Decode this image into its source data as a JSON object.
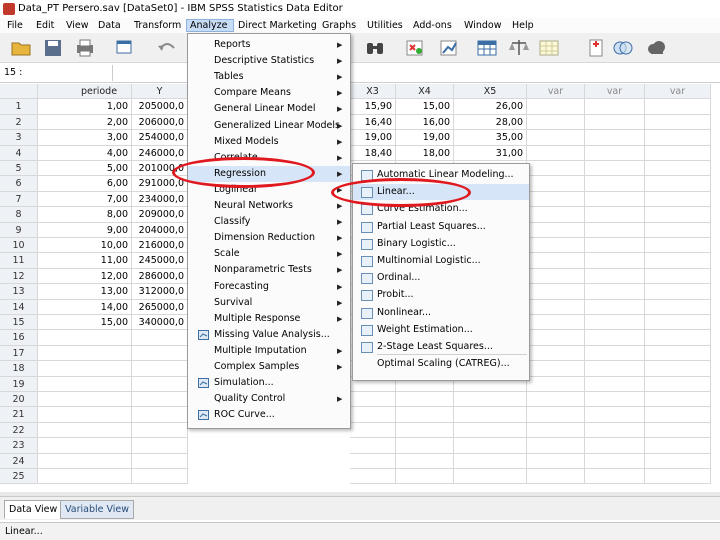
{
  "window": {
    "title": "Data_PT Persero.sav [DataSet0] - IBM SPSS Statistics Data Editor"
  },
  "menubar": [
    "File",
    "Edit",
    "View",
    "Data",
    "Transform",
    "Analyze",
    "Direct Marketing",
    "Graphs",
    "Utilities",
    "Add-ons",
    "Window",
    "Help"
  ],
  "toolbar_icons": [
    "open-icon",
    "save-icon",
    "print-icon",
    "dialog-recall-icon",
    "undo-icon",
    "binoculars-icon",
    "cases-icon",
    "chart-icon",
    "table-icon",
    "scale-icon",
    "select-icon",
    "value-labels-icon",
    "sets-icon",
    "cloud-icon"
  ],
  "editbar": {
    "cell_ref": "15 :",
    "cell_value": ""
  },
  "grid": {
    "columns": [
      "periode",
      "Y",
      "X3",
      "X4",
      "X5",
      "var",
      "var",
      "var"
    ],
    "row_numbers": [
      "1",
      "2",
      "3",
      "4",
      "5",
      "6",
      "7",
      "8",
      "9",
      "10",
      "11",
      "12",
      "13",
      "14",
      "15",
      "16",
      "17",
      "18",
      "19",
      "20",
      "21",
      "22",
      "23",
      "24",
      "25"
    ],
    "rows": [
      [
        "1,00",
        "205000,0",
        "15,90",
        "15,00",
        "26,00"
      ],
      [
        "2,00",
        "206000,0",
        "16,40",
        "16,00",
        "28,00"
      ],
      [
        "3,00",
        "254000,0",
        "19,00",
        "19,00",
        "35,00"
      ],
      [
        "4,00",
        "246000,0",
        "18,40",
        "18,00",
        "31,00"
      ],
      [
        "5,00",
        "201000,0",
        "",
        "",
        ""
      ],
      [
        "6,00",
        "291000,0",
        "",
        "",
        ""
      ],
      [
        "7,00",
        "234000,0",
        "",
        "",
        ""
      ],
      [
        "8,00",
        "209000,0",
        "",
        "",
        ""
      ],
      [
        "9,00",
        "204000,0",
        "",
        "",
        ""
      ],
      [
        "10,00",
        "216000,0",
        "",
        "",
        ""
      ],
      [
        "11,00",
        "245000,0",
        "",
        "",
        ""
      ],
      [
        "12,00",
        "286000,0",
        "",
        "",
        ""
      ],
      [
        "13,00",
        "312000,0",
        "",
        "",
        ""
      ],
      [
        "14,00",
        "265000,0",
        "",
        "",
        ""
      ],
      [
        "15,00",
        "340000,0",
        "",
        "",
        ""
      ]
    ]
  },
  "analyze_menu": [
    {
      "label": "Reports",
      "submenu": true
    },
    {
      "label": "Descriptive Statistics",
      "submenu": true
    },
    {
      "label": "Tables",
      "submenu": true
    },
    {
      "label": "Compare Means",
      "submenu": true
    },
    {
      "label": "General Linear Model",
      "submenu": true
    },
    {
      "label": "Generalized Linear Models",
      "submenu": true
    },
    {
      "label": "Mixed Models",
      "submenu": true
    },
    {
      "label": "Correlate",
      "submenu": true
    },
    {
      "label": "Regression",
      "submenu": true,
      "highlighted": true
    },
    {
      "label": "Loglinear",
      "submenu": true
    },
    {
      "label": "Neural Networks",
      "submenu": true
    },
    {
      "label": "Classify",
      "submenu": true
    },
    {
      "label": "Dimension Reduction",
      "submenu": true
    },
    {
      "label": "Scale",
      "submenu": true
    },
    {
      "label": "Nonparametric Tests",
      "submenu": true
    },
    {
      "label": "Forecasting",
      "submenu": true
    },
    {
      "label": "Survival",
      "submenu": true
    },
    {
      "label": "Multiple Response",
      "submenu": true
    },
    {
      "label": "Missing Value Analysis...",
      "submenu": false,
      "icon": "missing-value-icon"
    },
    {
      "label": "Multiple Imputation",
      "submenu": true
    },
    {
      "label": "Complex Samples",
      "submenu": true
    },
    {
      "label": "Simulation...",
      "submenu": false,
      "icon": "simulation-icon"
    },
    {
      "label": "Quality Control",
      "submenu": true
    },
    {
      "label": "ROC Curve...",
      "submenu": false,
      "icon": "roc-curve-icon"
    }
  ],
  "regression_menu": [
    {
      "label": "Automatic Linear Modeling...",
      "icon": "auto-linear-icon"
    },
    {
      "label": "Linear...",
      "icon": "linear-icon",
      "highlighted": true
    },
    {
      "label": "Curve Estimation...",
      "icon": "curve-icon"
    },
    {
      "label": "Partial Least Squares...",
      "icon": "pls-icon"
    },
    {
      "label": "Binary Logistic...",
      "icon": "binary-logistic-icon"
    },
    {
      "label": "Multinomial Logistic...",
      "icon": "multinomial-icon"
    },
    {
      "label": "Ordinal...",
      "icon": "ordinal-icon"
    },
    {
      "label": "Probit...",
      "icon": "probit-icon"
    },
    {
      "label": "Nonlinear...",
      "icon": "nonlinear-icon"
    },
    {
      "label": "Weight Estimation...",
      "icon": "weight-icon"
    },
    {
      "label": "2-Stage Least Squares...",
      "icon": "two-stage-icon"
    },
    {
      "label": "Optimal Scaling (CATREG)...",
      "icon": ""
    }
  ],
  "tabs": {
    "data_view": "Data View",
    "variable_view": "Variable View"
  },
  "status": {
    "text": "Linear..."
  },
  "colors": {
    "annotation": "#e0191f",
    "highlight": "#d6e6f8",
    "menu_active": "#c7dcf5"
  }
}
